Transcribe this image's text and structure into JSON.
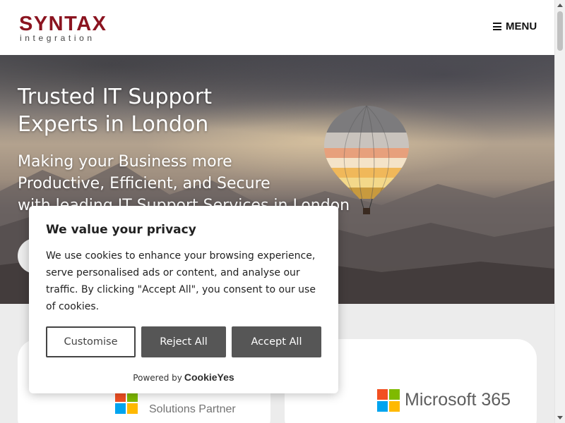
{
  "header": {
    "logo_main": "SYNTAX",
    "logo_sub": "integration",
    "menu_label": "MENU"
  },
  "hero": {
    "title_line1": "Trusted IT Support",
    "title_line2": "Experts in London",
    "subtitle_line1": "Making your Business more",
    "subtitle_line2": "Productive, Efficient, and Secure",
    "subtitle_line3": "with leading IT Support Services in London"
  },
  "cookie_banner": {
    "title": "We value your privacy",
    "text": "We use cookies to enhance your browsing experience, serve personalised ads or content, and analyse our traffic. By clicking \"Accept All\", you consent to our use of cookies.",
    "customise_label": "Customise",
    "reject_label": "Reject All",
    "accept_label": "Accept All",
    "powered_by": "Powered by",
    "powered_brand": "CookieYes"
  },
  "partners": {
    "left_top": "Microsoft",
    "left_bottom": "Solutions Partner",
    "right": "Microsoft 365"
  },
  "colors": {
    "brand_red": "#8b1420",
    "ms_red": "#f25022",
    "ms_green": "#7fba00",
    "ms_blue": "#00a4ef",
    "ms_yellow": "#ffb900",
    "button_dark": "#565656"
  }
}
